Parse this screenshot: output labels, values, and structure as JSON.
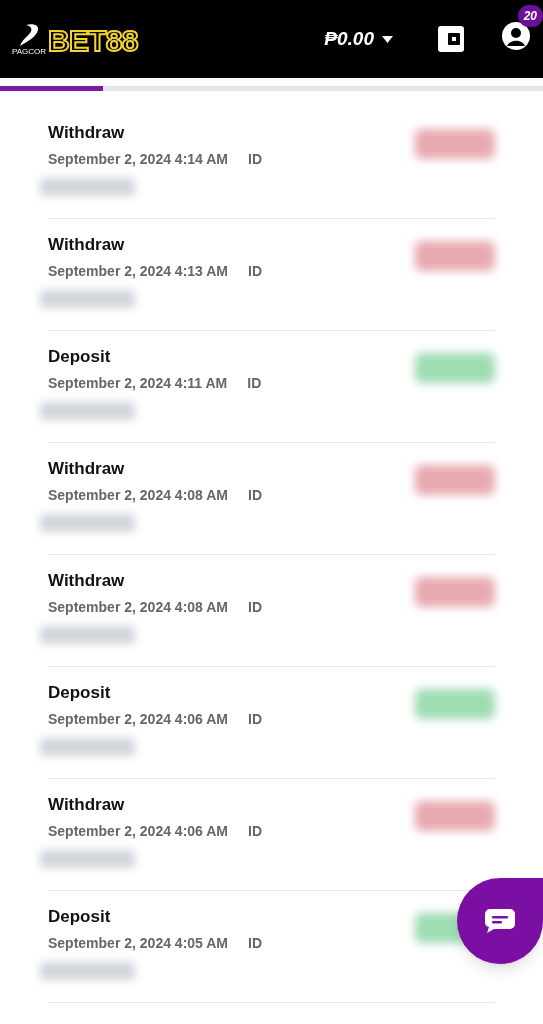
{
  "header": {
    "logo_text": "BET88",
    "logo_caption": "PAGCOR",
    "balance": "₱0.00",
    "notification_count": "20"
  },
  "progress": {
    "level": 0.19
  },
  "transactions": [
    {
      "kind": "withdraw",
      "title": "Withdraw",
      "date": "September 2, 2024 4:14 AM",
      "id_label": "ID"
    },
    {
      "kind": "withdraw",
      "title": "Withdraw",
      "date": "September 2, 2024 4:13 AM",
      "id_label": "ID"
    },
    {
      "kind": "deposit",
      "title": "Deposit",
      "date": "September 2, 2024 4:11 AM",
      "id_label": "ID"
    },
    {
      "kind": "withdraw",
      "title": "Withdraw",
      "date": "September 2, 2024 4:08 AM",
      "id_label": "ID"
    },
    {
      "kind": "withdraw",
      "title": "Withdraw",
      "date": "September 2, 2024 4:08 AM",
      "id_label": "ID"
    },
    {
      "kind": "deposit",
      "title": "Deposit",
      "date": "September 2, 2024 4:06 AM",
      "id_label": "ID"
    },
    {
      "kind": "withdraw",
      "title": "Withdraw",
      "date": "September 2, 2024 4:06 AM",
      "id_label": "ID"
    },
    {
      "kind": "deposit",
      "title": "Deposit",
      "date": "September 2, 2024 4:05 AM",
      "id_label": "ID"
    }
  ]
}
